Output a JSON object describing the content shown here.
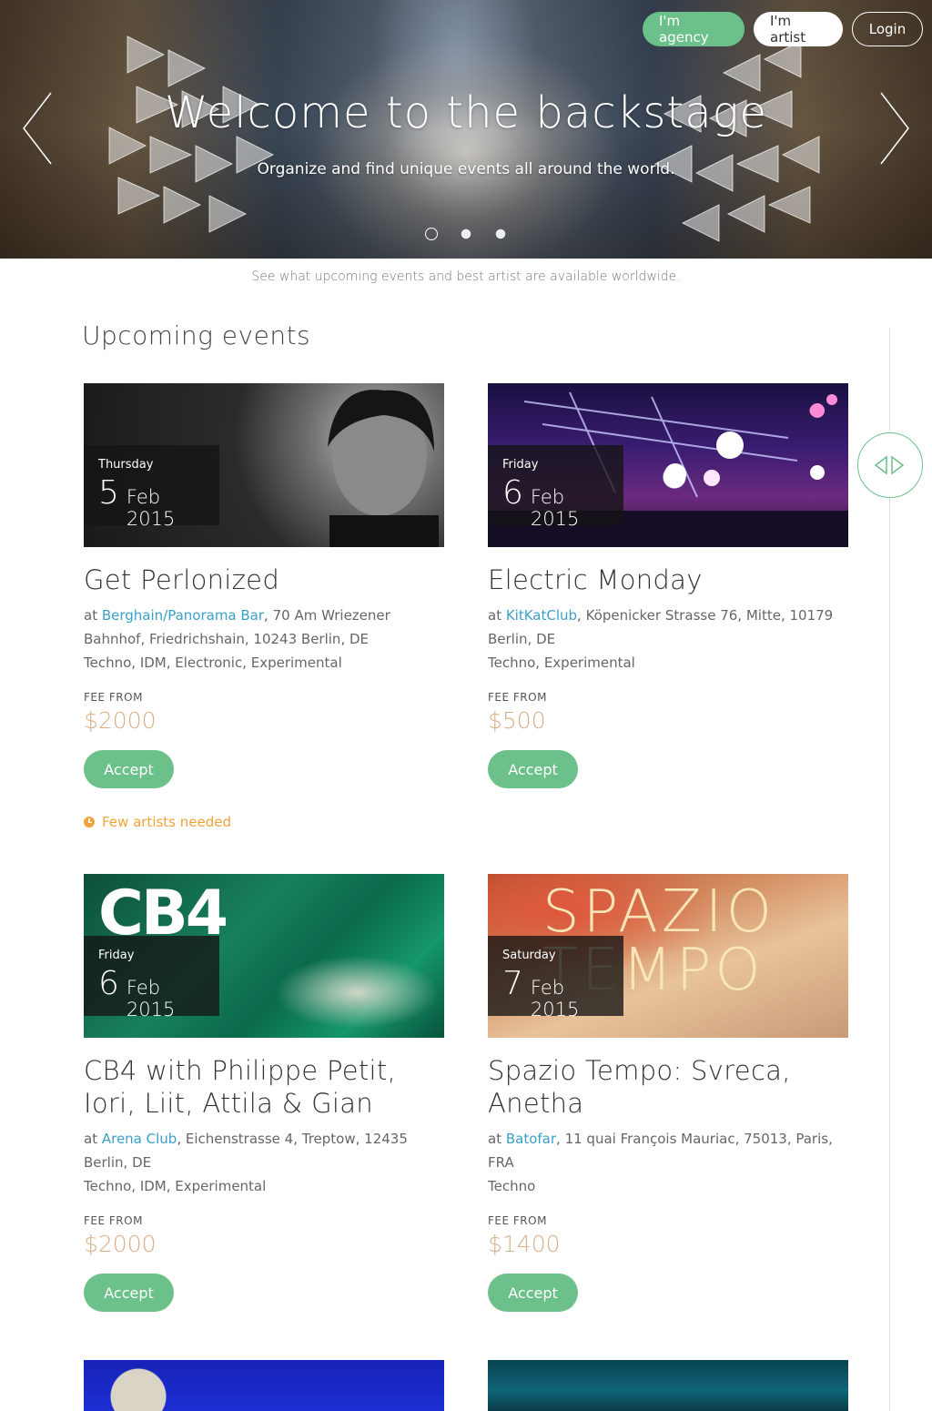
{
  "nav": {
    "agency_label": "I'm agency",
    "artist_label": "I'm artist",
    "login_label": "Login"
  },
  "hero": {
    "title": "Welcome to the backstage",
    "subtitle": "Organize and find unique events all around the world.",
    "slides": 3,
    "active_slide": 1
  },
  "tagline": "See what upcoming events and best artist are available worldwide.",
  "section": {
    "title": "Upcoming events"
  },
  "colors": {
    "accent": "#6cc18a",
    "link": "#3aa0c8",
    "fee": "#d8b08a",
    "warning": "#f2a43a"
  },
  "events": [
    {
      "weekday": "Thursday",
      "day": "5",
      "month_year": "Feb 2015",
      "title": "Get Perlonized",
      "venue_prefix": "at ",
      "venue": "Berghain/Panorama Bar",
      "address": ", 70 Am Wriezener Bahnhof, Friedrichshain, 10243 Berlin, DE",
      "genres": "Techno, IDM, Electronic, Experimental",
      "fee_label": "FEE FROM",
      "fee": "$2000",
      "accept_label": "Accept",
      "notice": "Few artists needed"
    },
    {
      "weekday": "Friday",
      "day": "6",
      "month_year": "Feb 2015",
      "title": "Electric Monday",
      "venue_prefix": "at ",
      "venue": "KitKatClub",
      "address": ", Köpenicker Strasse 76, Mitte, 10179 Berlin, DE",
      "genres": "Techno, Experimental",
      "fee_label": "FEE FROM",
      "fee": "$500",
      "accept_label": "Accept"
    },
    {
      "weekday": "Friday",
      "day": "6",
      "month_year": "Feb 2015",
      "title": "CB4 with Philippe Petit, Iori, Liit, Attila & Gian",
      "venue_prefix": "at ",
      "venue": "Arena Club",
      "address": ", Eichenstrasse 4, Treptow, 12435 Berlin, DE",
      "genres": "Techno, IDM, Experimental",
      "fee_label": "FEE FROM",
      "fee": "$2000",
      "accept_label": "Accept",
      "image_text": "CB4"
    },
    {
      "weekday": "Saturday",
      "day": "7",
      "month_year": "Feb 2015",
      "title": "Spazio Tempo: Svreca, Anetha",
      "venue_prefix": "at ",
      "venue": "Batofar",
      "address": ", 11 quai François Mauriac, 75013, Paris, FRA",
      "genres": "Techno",
      "fee_label": "FEE FROM",
      "fee": "$1400",
      "accept_label": "Accept",
      "image_text_1": "SPAZIO",
      "image_text_2": "TEMPO"
    }
  ]
}
